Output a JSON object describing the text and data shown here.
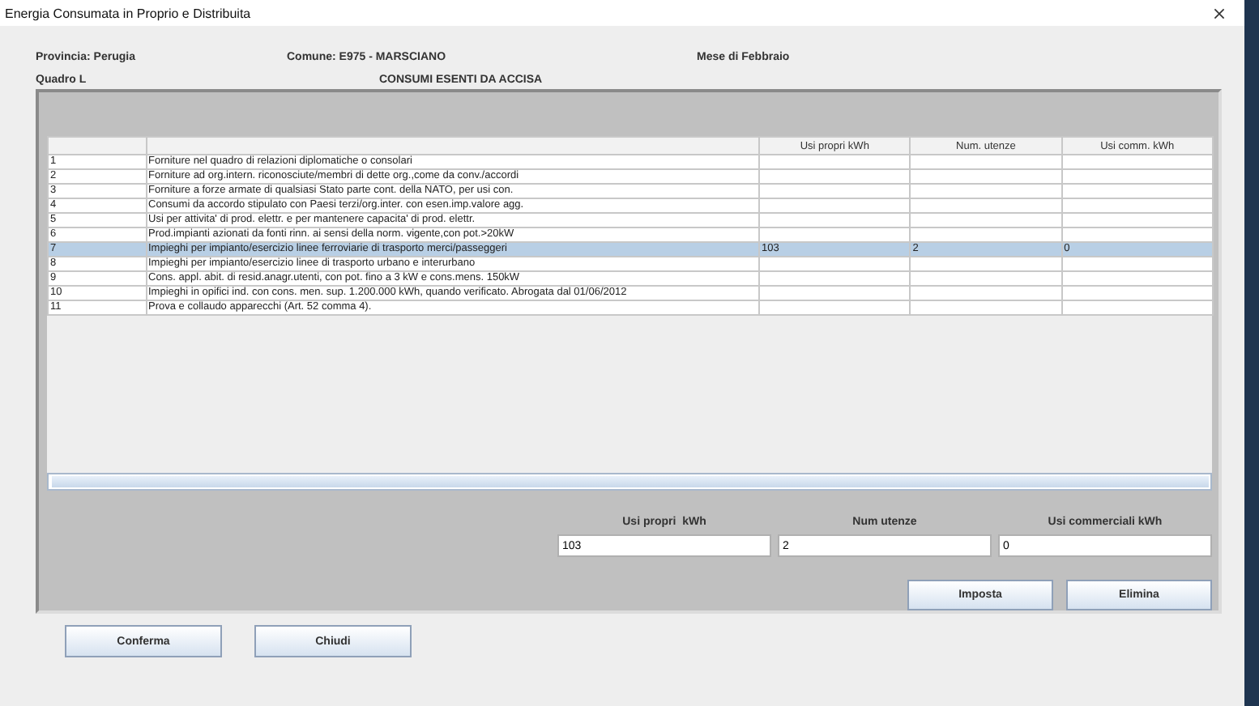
{
  "window": {
    "title": "Energia Consumata in Proprio e Distribuita"
  },
  "header": {
    "provincia": "Provincia: Perugia",
    "comune": "Comune: E975 - MARSCIANO",
    "mese": "Mese di Febbraio",
    "quadro": "Quadro L",
    "section_title": "CONSUMI ESENTI DA ACCISA"
  },
  "table": {
    "columns": [
      "Usi propri kWh",
      "Num. utenze",
      "Usi comm. kWh"
    ],
    "rows": [
      {
        "number": "1",
        "description": "Forniture nel quadro di relazioni diplomatiche o consolari",
        "selected": false
      },
      {
        "number": "2",
        "description": "Forniture ad org.intern. riconosciute/membri di dette org.,come da conv./accordi",
        "selected": false
      },
      {
        "number": "3",
        "description": "Forniture a forze armate di qualsiasi Stato parte cont. della NATO, per usi con.",
        "selected": false
      },
      {
        "number": "4",
        "description": "Consumi da accordo stipulato con Paesi terzi/org.inter. con esen.imp.valore agg.",
        "selected": false
      },
      {
        "number": "5",
        "description": "Usi per attivita' di prod. elettr. e per mantenere capacita' di prod. elettr.",
        "selected": false
      },
      {
        "number": "6",
        "description": "Prod.impianti azionati da fonti rinn. ai sensi della norm. vigente,con pot.>20kW",
        "selected": false
      },
      {
        "number": "7",
        "description": "Impieghi per impianto/esercizio linee ferroviarie di trasporto merci/passeggeri",
        "usi_propri": "103",
        "num_utenze": "2",
        "usi_comm": "0",
        "selected": true
      },
      {
        "number": "8",
        "description": "Impieghi per impianto/esercizio linee di trasporto urbano e interurbano",
        "selected": false
      },
      {
        "number": "9",
        "description": "Cons. appl. abit. di resid.anagr.utenti, con pot. fino a 3 kW e cons.mens. 150kW",
        "selected": false
      },
      {
        "number": "10",
        "description": "Impieghi in opifici ind. con cons. men. sup. 1.200.000 kWh, quando verificato. Abrogata dal 01/06/2012",
        "selected": false
      },
      {
        "number": "11",
        "description": "Prova e collaudo apparecchi (Art. 52 comma 4).",
        "selected": false
      }
    ]
  },
  "form": {
    "fields": [
      {
        "label": "Usi propri  kWh",
        "value": "103"
      },
      {
        "label": "Num utenze",
        "value": "2"
      },
      {
        "label": "Usi commerciali kWh",
        "value": "0"
      }
    ],
    "buttons": [
      "Imposta",
      "Elimina"
    ]
  },
  "footer_buttons": [
    "Conferma",
    "Chiudi"
  ]
}
